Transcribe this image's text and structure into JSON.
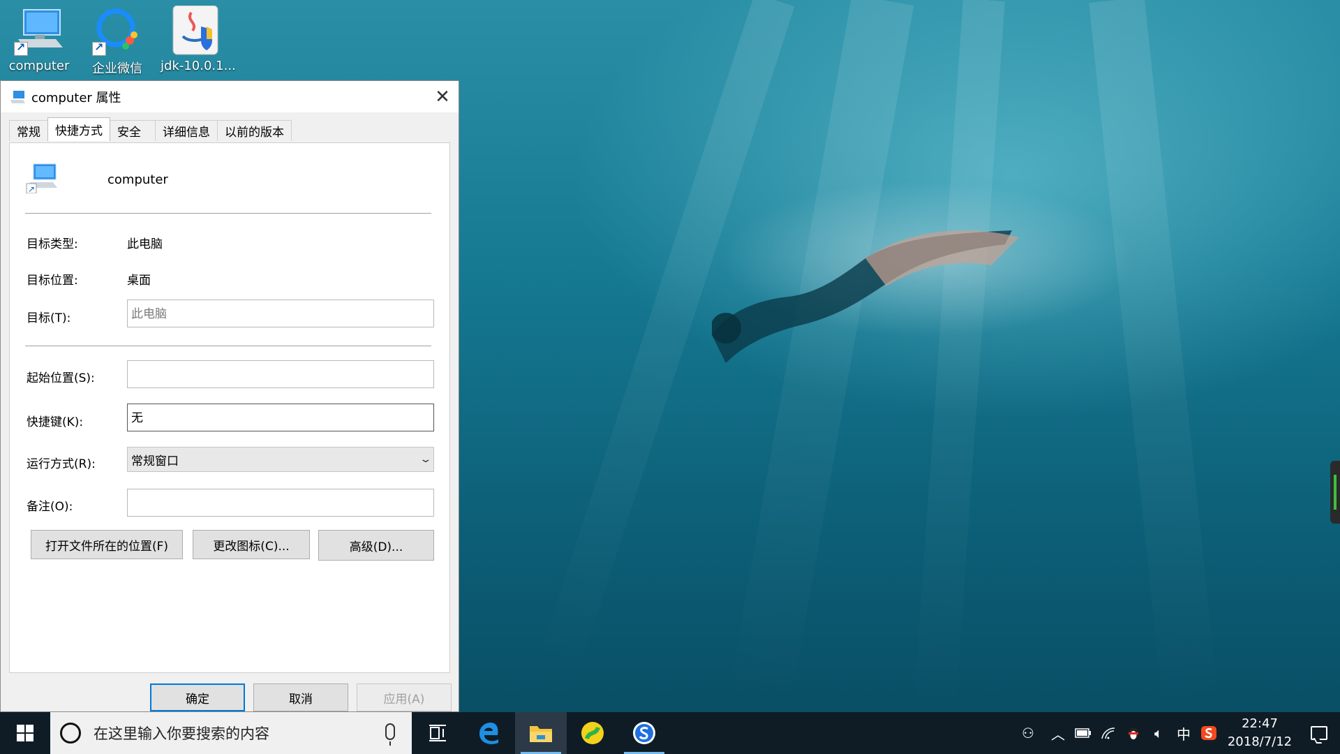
{
  "desktop": {
    "icons": [
      {
        "label": "computer",
        "icon": "computer-shortcut-icon"
      },
      {
        "label": "企业微信",
        "icon": "wecom-icon"
      },
      {
        "label": "jdk-10.0.1...",
        "icon": "java-installer-icon"
      }
    ]
  },
  "dialog": {
    "title": "computer 属性",
    "tabs": [
      "常规",
      "快捷方式",
      "安全",
      "详细信息",
      "以前的版本"
    ],
    "active_tab": "快捷方式",
    "shortcut_name": "computer",
    "target_type_label": "目标类型:",
    "target_type_value": "此电脑",
    "target_location_label": "目标位置:",
    "target_location_value": "桌面",
    "target_label": "目标(T):",
    "target_value": "此电脑",
    "start_in_label": "起始位置(S):",
    "start_in_value": "",
    "hotkey_label": "快捷键(K):",
    "hotkey_value": "无",
    "run_label": "运行方式(R):",
    "run_value": "常规窗口",
    "comment_label": "备注(O):",
    "comment_value": "",
    "open_location_btn": "打开文件所在的位置(F)",
    "change_icon_btn": "更改图标(C)...",
    "advanced_btn": "高级(D)...",
    "ok_btn": "确定",
    "cancel_btn": "取消",
    "apply_btn": "应用(A)"
  },
  "taskbar": {
    "search_placeholder": "在这里输入你要搜索的内容",
    "tray_ime": "中",
    "clock_time": "22:47",
    "clock_date": "2018/7/12"
  }
}
